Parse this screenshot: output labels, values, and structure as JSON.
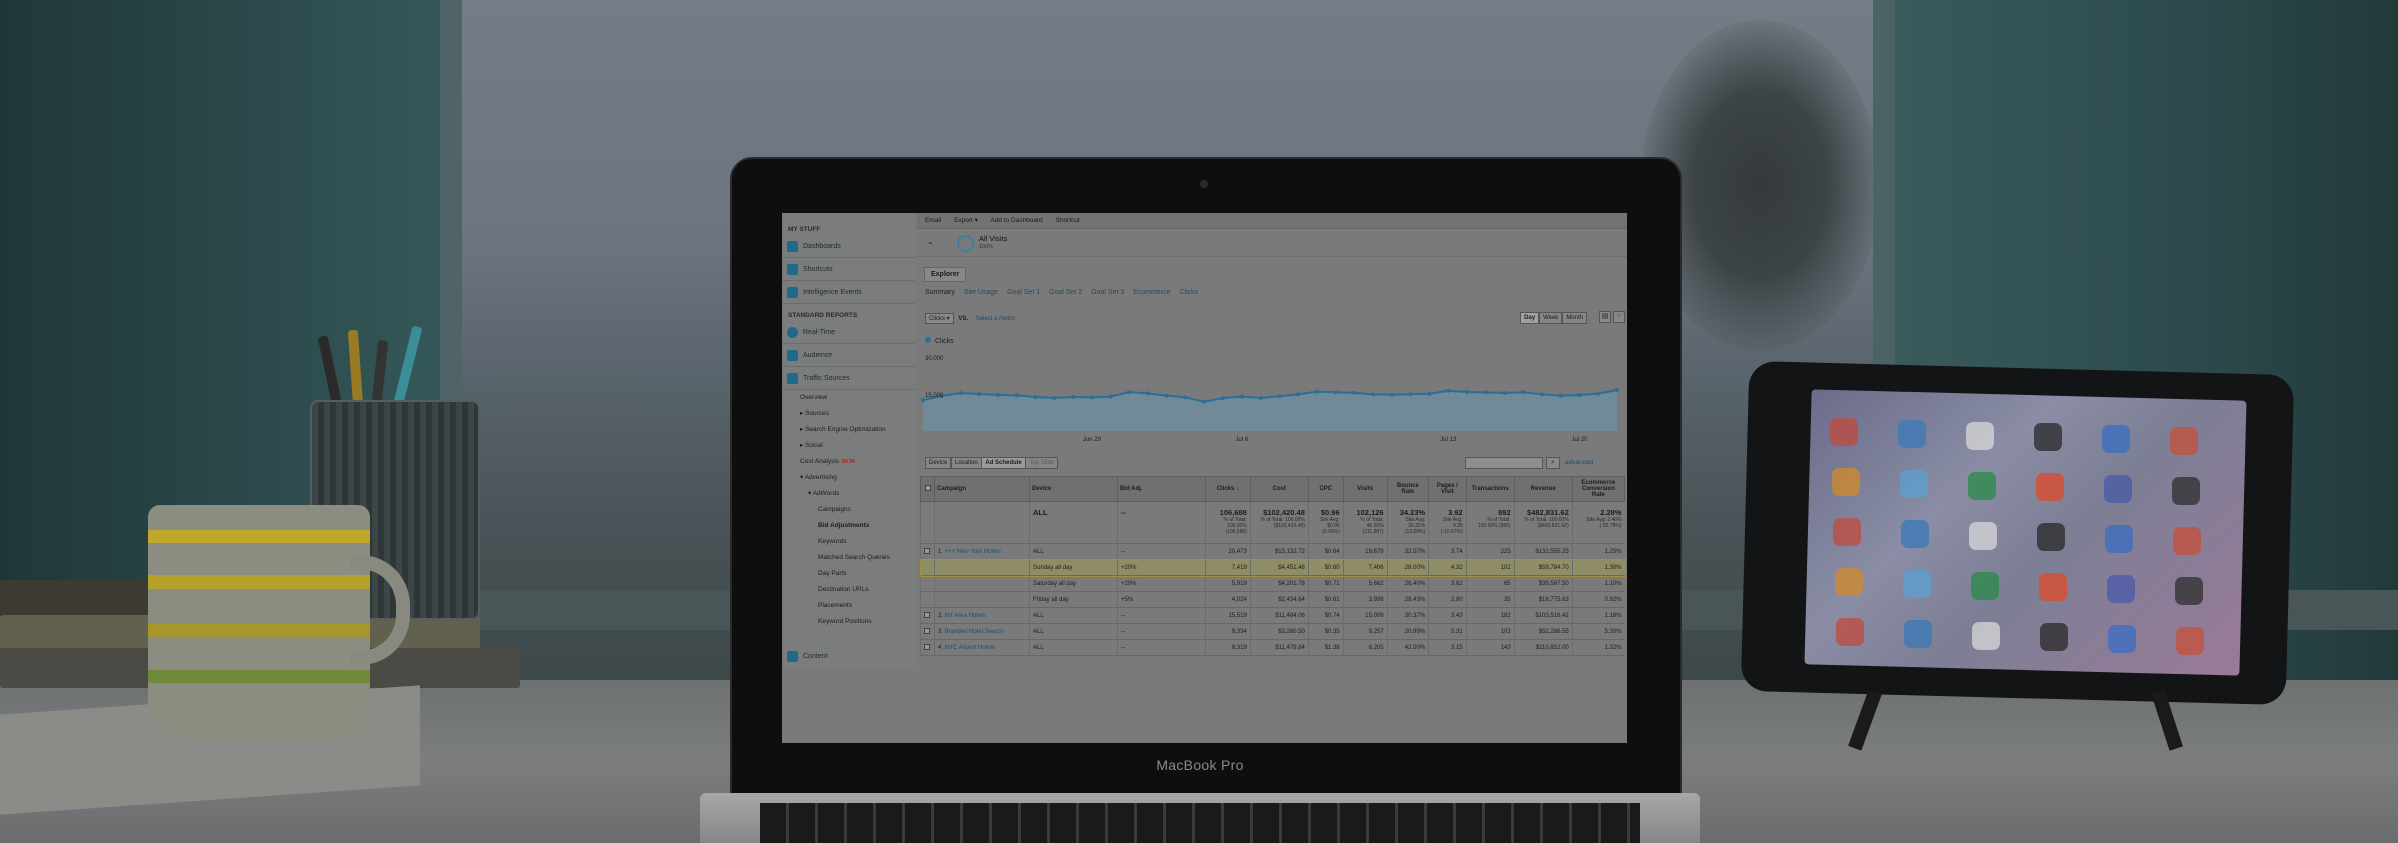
{
  "laptop": {
    "brand": "MacBook Pro"
  },
  "topbar": {
    "items": [
      "Email",
      "Export ▾",
      "Add to Dashboard",
      "Shortcut"
    ]
  },
  "segment": {
    "label": "All Visits",
    "percent": "100%"
  },
  "explorer_tab": "Explorer",
  "subtabs": [
    "Summary",
    "Site Usage",
    "Goal Set 1",
    "Goal Set 2",
    "Goal Set 3",
    "Ecommerce",
    "Clicks"
  ],
  "metric": {
    "selected": "Clicks",
    "vs": "VS.",
    "select_link": "Select a metric"
  },
  "period": [
    "Day",
    "Week",
    "Month"
  ],
  "chart_data": {
    "type": "area",
    "legend": "Clicks",
    "y_top_label": "30,000",
    "y_mid_label": "15,000",
    "x_tick_labels": [
      "Jun 29",
      "Jul 6",
      "Jul 13",
      "Jul 20"
    ],
    "values": [
      15500,
      17500,
      19000,
      18500,
      18000,
      17800,
      17000,
      16500,
      17000,
      16800,
      17200,
      19500,
      18800,
      17700,
      16800,
      14600,
      16500,
      17200,
      16500,
      17400,
      18300,
      19700,
      19400,
      19100,
      18300,
      18100,
      18400,
      18600,
      20100,
      19500,
      19300,
      19000,
      19400,
      18300,
      17600,
      18000,
      18700,
      20500
    ],
    "ylim": [
      0,
      35000
    ]
  },
  "controls": {
    "tabs": [
      "Device",
      "Location",
      "Ad Schedule",
      "Top Slots"
    ],
    "advanced": "advanced"
  },
  "table": {
    "headers": [
      "Campaign",
      "Device",
      "Bid Adj.",
      "Clicks ↓",
      "Cost",
      "CPC",
      "Visits",
      "Bounce Rate",
      "Pages / Visit",
      "Transactions",
      "Revenue",
      "Ecommerce Conversion Rate"
    ],
    "total": {
      "label": "ALL",
      "bid": "--",
      "values": [
        "106,688",
        "$102,420.48",
        "$0.96",
        "102,126",
        "34.23%",
        "3.92",
        "892",
        "$482,831.62",
        "2.28%"
      ],
      "subs": [
        "% of Total: 100.00% (106,688)",
        "% of Total: 100.00% ($102,420.48)",
        "Site Avg: $0.96 (0.00%)",
        "% of Total: 46.00% (211,887)",
        "Site Avg: 26.32% (13.08%)",
        "Site Avg: 4.39 (-10.67%)",
        "% of Total: 100.00% (980)",
        "% of Total: 100.00% ($482,831.62)",
        "Site Avg: 2.46% (-32.78%)"
      ]
    },
    "rows": [
      {
        "num": "1.",
        "campaign": "+++ New York Hotels",
        "device": "ALL",
        "bid": "--",
        "values": [
          "20,473",
          "$13,132.72",
          "$0.64",
          "19,679",
          "32.07%",
          "3.74",
          "225",
          "$132,555.25",
          "1.25%"
        ],
        "highlight": false
      },
      {
        "num": "",
        "campaign": "",
        "device": "Sunday all day",
        "bid": "+20%",
        "values": [
          "7,419",
          "$4,451.48",
          "$0.60",
          "7,406",
          "28.00%",
          "4.32",
          "102",
          "$59,784.70",
          "1.30%"
        ],
        "highlight": true
      },
      {
        "num": "",
        "campaign": "",
        "device": "Saturday all day",
        "bid": "+20%",
        "values": [
          "5,919",
          "$4,201.78",
          "$0.71",
          "5,662",
          "26.40%",
          "3.62",
          "65",
          "$39,587.50",
          "1.10%"
        ],
        "highlight": false
      },
      {
        "num": "",
        "campaign": "",
        "device": "Friday all day",
        "bid": "+5%",
        "values": [
          "4,024",
          "$2,434.64",
          "$0.61",
          "3,998",
          "28.43%",
          "2.80",
          "35",
          "$18,775.63",
          "0.92%"
        ],
        "highlight": false
      },
      {
        "num": "2.",
        "campaign": "NY Area Hotels",
        "device": "ALL",
        "bid": "--",
        "values": [
          "15,519",
          "$11,484.06",
          "$0.74",
          "15,008",
          "30.37%",
          "3.43",
          "182",
          "$103,516.42",
          "1.18%"
        ],
        "highlight": false
      },
      {
        "num": "3.",
        "campaign": "Branded Hotel Search",
        "device": "ALL",
        "bid": "--",
        "values": [
          "9,334",
          "$3,260.50",
          "$0.35",
          "9,257",
          "20.99%",
          "5.31",
          "103",
          "$52,286.55",
          "5.30%"
        ],
        "highlight": false
      },
      {
        "num": "4.",
        "campaign": "NYC Airport Hotels",
        "device": "ALL",
        "bid": "--",
        "values": [
          "8,319",
          "$11,479.84",
          "$1.38",
          "8,205",
          "42.00%",
          "3.15",
          "143",
          "$110,852.00",
          "1.32%"
        ],
        "highlight": false
      }
    ]
  },
  "sidebar": {
    "my_stuff": "MY STUFF",
    "standard_reports": "STANDARD REPORTS",
    "main_items": [
      "Dashboards",
      "Shortcuts",
      "Intelligence Events"
    ],
    "report_items": [
      "Real-Time",
      "Audience",
      "Traffic Sources"
    ],
    "traffic_subs": [
      "Overview",
      "▸ Sources",
      "▸ Search Engine Optimization",
      "▸ Social",
      "Cost Analysis",
      "▾ Advertising",
      "▾ AdWords"
    ],
    "new_badge": "BETA",
    "adwords_subs": [
      "Campaigns",
      "Bid Adjustments",
      "Keywords",
      "Matched Search Queries",
      "Day Parts",
      "Destination URLs",
      "Placements",
      "Keyword Positions"
    ],
    "content": "Content"
  },
  "colors": {
    "accent": "#2a6f97",
    "chart_fill": "#6e8d9c",
    "highlight": "#8f8d65"
  }
}
